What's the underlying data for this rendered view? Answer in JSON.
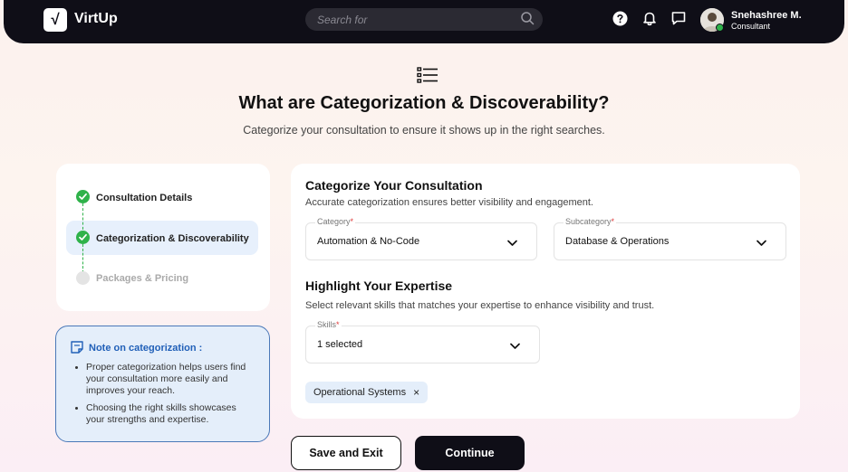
{
  "app": {
    "name": "VirtUp",
    "logo_glyph": "√"
  },
  "search": {
    "placeholder": "Search for"
  },
  "user": {
    "name": "Snehashree M.",
    "role": "Consultant"
  },
  "header": {
    "title": "What are Categorization & Discoverability?",
    "subtitle": "Categorize your consultation to ensure it shows up in the right searches."
  },
  "steps": [
    {
      "label": "Consultation Details",
      "status": "completed"
    },
    {
      "label": "Categorization & Discoverability",
      "status": "active"
    },
    {
      "label": "Packages & Pricing",
      "status": "pending"
    }
  ],
  "note": {
    "title": "Note on categorization :",
    "points": [
      "Proper categorization helps users find your consultation more easily and improves your reach.",
      "Choosing the right skills showcases your strengths and expertise."
    ]
  },
  "categorize": {
    "title": "Categorize Your Consultation",
    "description": "Accurate categorization ensures better visibility and engagement.",
    "category": {
      "label": "Category",
      "required_mark": "*",
      "value": "Automation & No-Code"
    },
    "subcategory": {
      "label": "Subcategory",
      "required_mark": "*",
      "value": "Database & Operations"
    }
  },
  "expertise": {
    "title": "Highlight Your Expertise",
    "description": "Select relevant skills that matches your expertise to enhance visibility and trust.",
    "skills": {
      "label": "Skills",
      "required_mark": "*",
      "value": "1 selected"
    },
    "chips": [
      {
        "label": "Operational Systems",
        "remove_glyph": "×"
      }
    ]
  },
  "actions": {
    "save_exit": "Save and Exit",
    "continue": "Continue"
  },
  "colors": {
    "nav_bg": "#0f0e17",
    "accent_blue": "#2160b8",
    "success_green": "#2fb24a",
    "active_step_bg": "#e7f0fc",
    "required_red": "#e03a3a"
  }
}
